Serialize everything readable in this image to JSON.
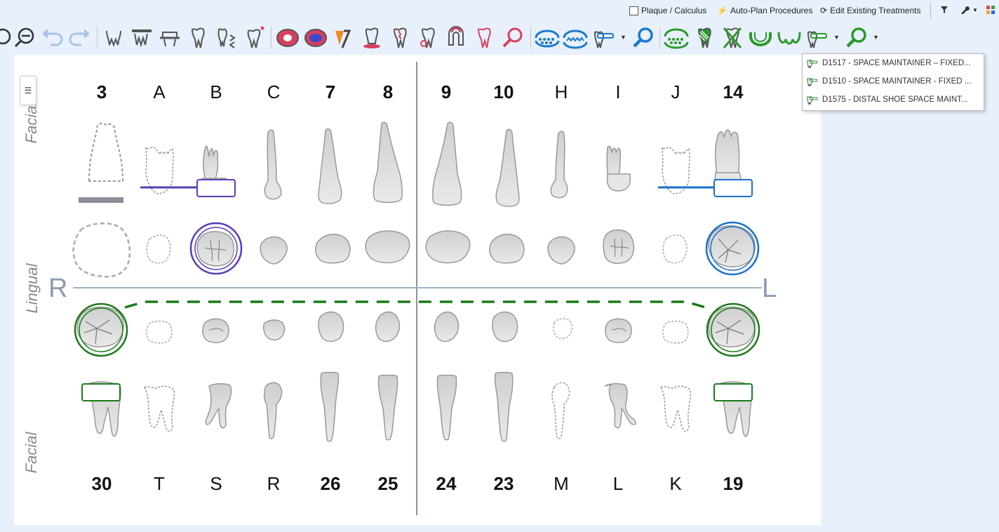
{
  "topbar": {
    "plaque_label": "Plaque / Calculus",
    "autoplan_label": "Auto-Plan Procedures",
    "edit_label": "Edit Existing Treatments"
  },
  "chart": {
    "upper_numbers": [
      "3",
      "A",
      "B",
      "C",
      "7",
      "8",
      "9",
      "10",
      "H",
      "I",
      "J",
      "14"
    ],
    "lower_numbers": [
      "30",
      "T",
      "S",
      "R",
      "26",
      "25",
      "24",
      "23",
      "M",
      "L",
      "K",
      "19"
    ],
    "facial_label": "Facial",
    "lingual_label": "Lingual",
    "right_label": "R",
    "left_label": "L"
  },
  "dropdown": {
    "items": [
      "D1517 - SPACE MAINTAINER – FIXED...",
      "D1510 - SPACE MAINTAINER - FIXED ...",
      "D1575 - DISTAL SHOE SPACE MAINT..."
    ]
  },
  "colors": {
    "background": "#e8f0fb",
    "green": "#1a7a1a",
    "blue": "#1a6fd0",
    "purple": "#5a3cb8",
    "toolbar_blue": "#1a7ad0",
    "toolbar_red": "#d84060",
    "toolbar_green": "#2a9a2a"
  }
}
